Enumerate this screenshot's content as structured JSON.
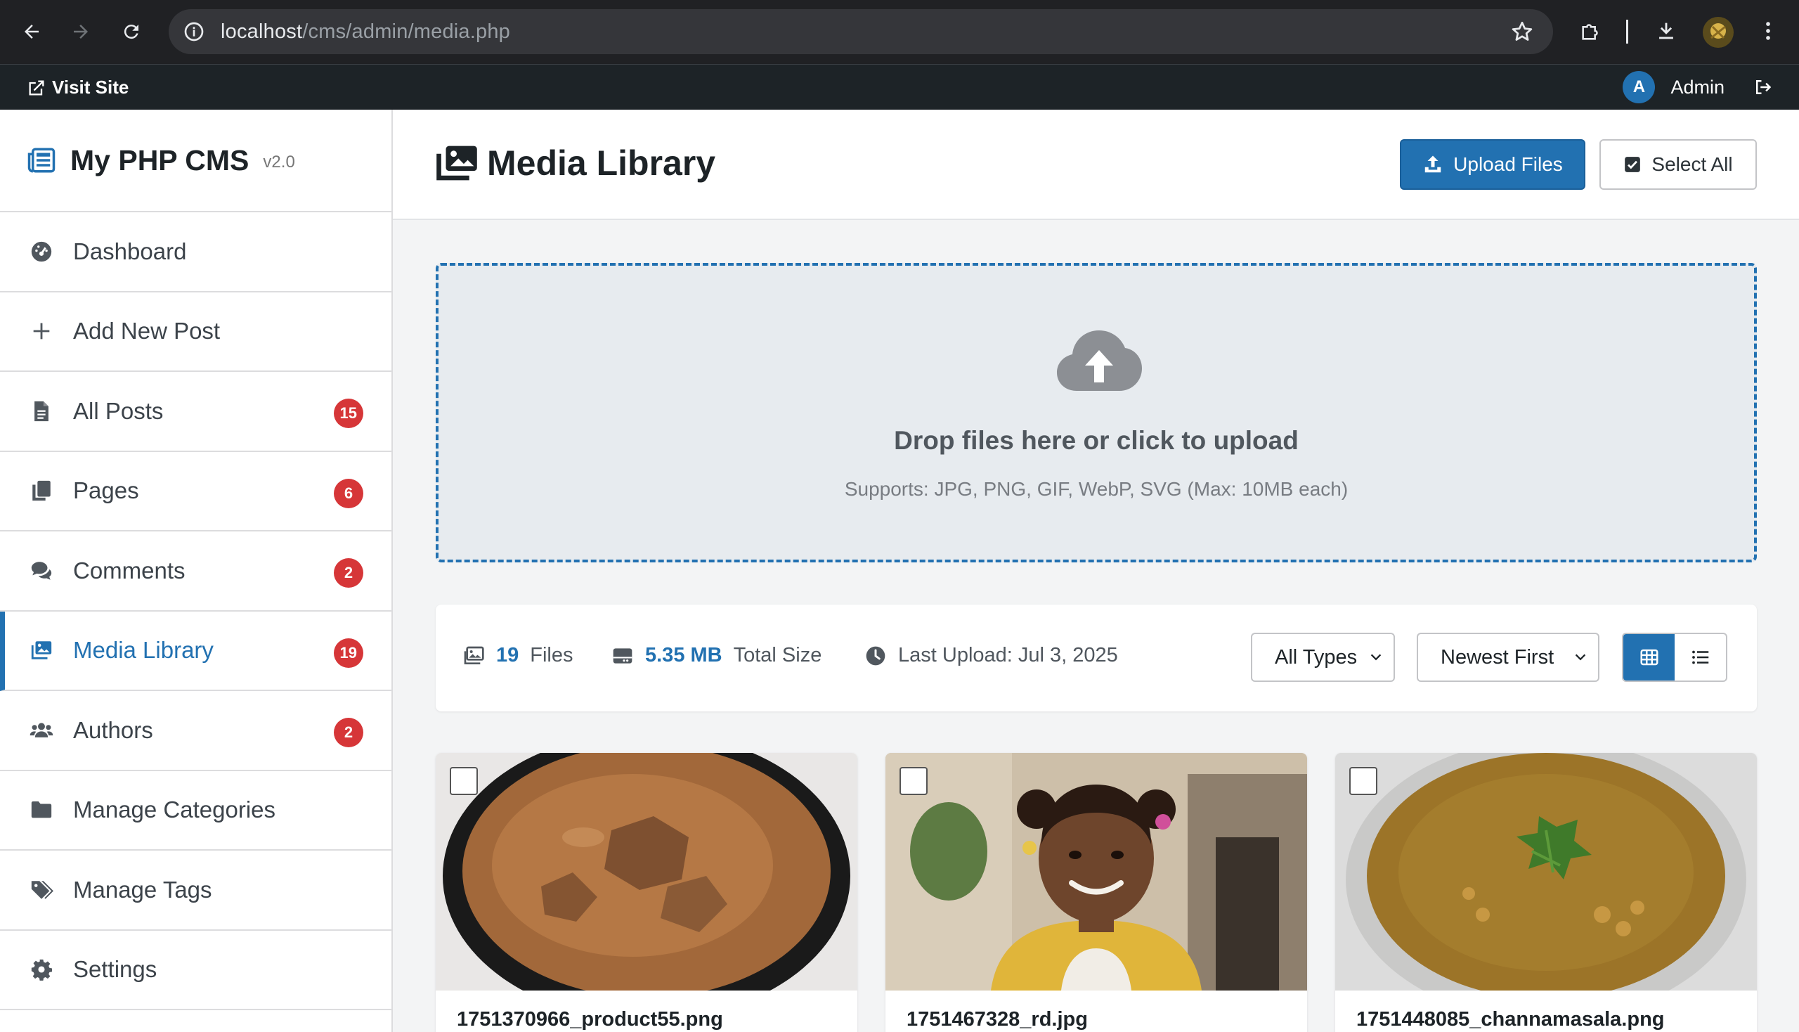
{
  "browser": {
    "url_host": "localhost",
    "url_path": "/cms/admin/media.php"
  },
  "admin_bar": {
    "visit_site": "Visit Site",
    "avatar_initial": "A",
    "user_name": "Admin"
  },
  "sidebar": {
    "brand": "My PHP CMS",
    "version": "v2.0",
    "items": [
      {
        "label": "Dashboard",
        "icon": "dashboard-icon",
        "badge": ""
      },
      {
        "label": "Add New Post",
        "icon": "plus-icon",
        "badge": ""
      },
      {
        "label": "All Posts",
        "icon": "file-icon",
        "badge": "15"
      },
      {
        "label": "Pages",
        "icon": "copy-icon",
        "badge": "6"
      },
      {
        "label": "Comments",
        "icon": "comments-icon",
        "badge": "2"
      },
      {
        "label": "Media Library",
        "icon": "images-icon",
        "badge": "19",
        "active": true
      },
      {
        "label": "Authors",
        "icon": "users-icon",
        "badge": "2"
      },
      {
        "label": "Manage Categories",
        "icon": "folder-icon",
        "badge": ""
      },
      {
        "label": "Manage Tags",
        "icon": "tags-icon",
        "badge": ""
      },
      {
        "label": "Settings",
        "icon": "gear-icon",
        "badge": ""
      }
    ]
  },
  "header": {
    "title": "Media Library",
    "upload_label": "Upload Files",
    "select_all_label": "Select All"
  },
  "dropzone": {
    "title": "Drop files here or click to upload",
    "subtitle": "Supports: JPG, PNG, GIF, WebP, SVG (Max: 10MB each)"
  },
  "stats": {
    "files_count": "19",
    "files_label": "Files",
    "size_value": "5.35 MB",
    "size_label": "Total Size",
    "last_upload": "Last Upload: Jul 3, 2025"
  },
  "filters": {
    "type_selected": "All Types",
    "sort_selected": "Newest First",
    "view": "grid"
  },
  "media": [
    {
      "filename": "1751370966_product55.png"
    },
    {
      "filename": "1751467328_rd.jpg"
    },
    {
      "filename": "1751448085_channamasala.png"
    }
  ],
  "colors": {
    "accent": "#2271b1",
    "badge": "#d63638",
    "admin_bar": "#1d2327"
  }
}
